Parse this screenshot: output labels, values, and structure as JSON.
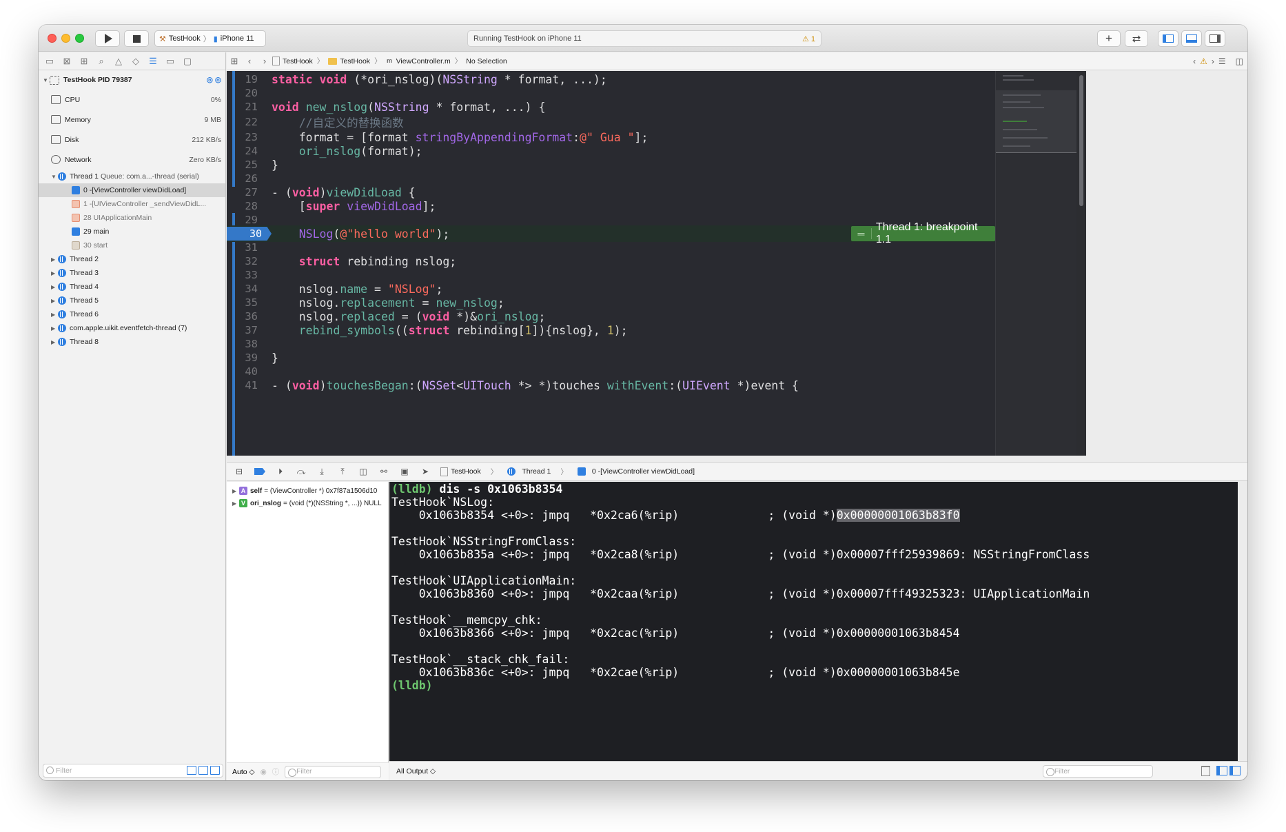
{
  "toolbar": {
    "scheme_project": "TestHook",
    "scheme_device": "iPhone 11",
    "activity_text": "Running TestHook on iPhone 11",
    "warning_count": "1"
  },
  "navigator": {
    "process": {
      "name": "TestHook",
      "pid": "PID 79387"
    },
    "gauges": [
      {
        "label": "CPU",
        "value": "0%"
      },
      {
        "label": "Memory",
        "value": "9 MB"
      },
      {
        "label": "Disk",
        "value": "212 KB/s"
      },
      {
        "label": "Network",
        "value": "Zero KB/s"
      }
    ],
    "thread1": {
      "name": "Thread 1",
      "queue": "Queue: com.a...-thread (serial)"
    },
    "frames": [
      {
        "label": "0 -[ViewController viewDidLoad]",
        "kind": "user"
      },
      {
        "label": "1 -[UIViewController _sendViewDidL...",
        "kind": "sys"
      },
      {
        "label": "28 UIApplicationMain",
        "kind": "sys"
      },
      {
        "label": "29 main",
        "kind": "user"
      },
      {
        "label": "30 start",
        "kind": "sysg"
      }
    ],
    "threads": [
      "Thread 2",
      "Thread 3",
      "Thread 4",
      "Thread 5",
      "Thread 6",
      "com.apple.uikit.eventfetch-thread (7)",
      "Thread 8"
    ],
    "filter_placeholder": "Filter"
  },
  "jumpbar": {
    "project": "TestHook",
    "group": "TestHook",
    "file": "ViewController.m",
    "selection": "No Selection"
  },
  "editor": {
    "current_line": "30",
    "breakpoint_label": "Thread 1: breakpoint 1.1",
    "line_numbers": [
      "19",
      "20",
      "21",
      "22",
      "23",
      "24",
      "25",
      "26",
      "27",
      "28",
      "29",
      "30",
      "31",
      "32",
      "33",
      "34",
      "35",
      "36",
      "37",
      "38",
      "39",
      "40",
      "41"
    ]
  },
  "debugbar": {
    "project": "TestHook",
    "thread": "Thread 1",
    "frame": "0 -[ViewController viewDidLoad]"
  },
  "variables": [
    {
      "badge": "A",
      "name": "self",
      "value": "= (ViewController *) 0x7f87a1506d10"
    },
    {
      "badge": "V",
      "name": "ori_nslog",
      "value": "= (void (*)(NSString *, ...)) NULL"
    }
  ],
  "variables_footer": {
    "mode": "Auto ◇",
    "filter_placeholder": "Filter"
  },
  "console": {
    "prompt": "(lldb)",
    "command": "dis -s 0x1063b8354",
    "lines": [
      "TestHook`NSLog:",
      "    0x1063b8354 <+0>: jmpq   *0x2ca6(%rip)             ; (void *)",
      "",
      "TestHook`NSStringFromClass:",
      "    0x1063b835a <+0>: jmpq   *0x2ca8(%rip)             ; (void *)0x00007fff25939869: NSStringFromClass",
      "",
      "TestHook`UIApplicationMain:",
      "    0x1063b8360 <+0>: jmpq   *0x2caa(%rip)             ; (void *)0x00007fff49325323: UIApplicationMain",
      "",
      "TestHook`__memcpy_chk:",
      "    0x1063b8366 <+0>: jmpq   *0x2cac(%rip)             ; (void *)0x00000001063b8454",
      "",
      "TestHook`__stack_chk_fail:",
      "    0x1063b836c <+0>: jmpq   *0x2cae(%rip)             ; (void *)0x00000001063b845e"
    ],
    "highlighted_address": "0x00000001063b83f0",
    "output_mode": "All Output ◇",
    "filter_placeholder": "Filter"
  },
  "colors": {
    "editor_bg": "#292a30",
    "console_bg": "#1e1f23",
    "accent": "#2f7fe0",
    "breakpoint_green": "#3f7f3a"
  }
}
